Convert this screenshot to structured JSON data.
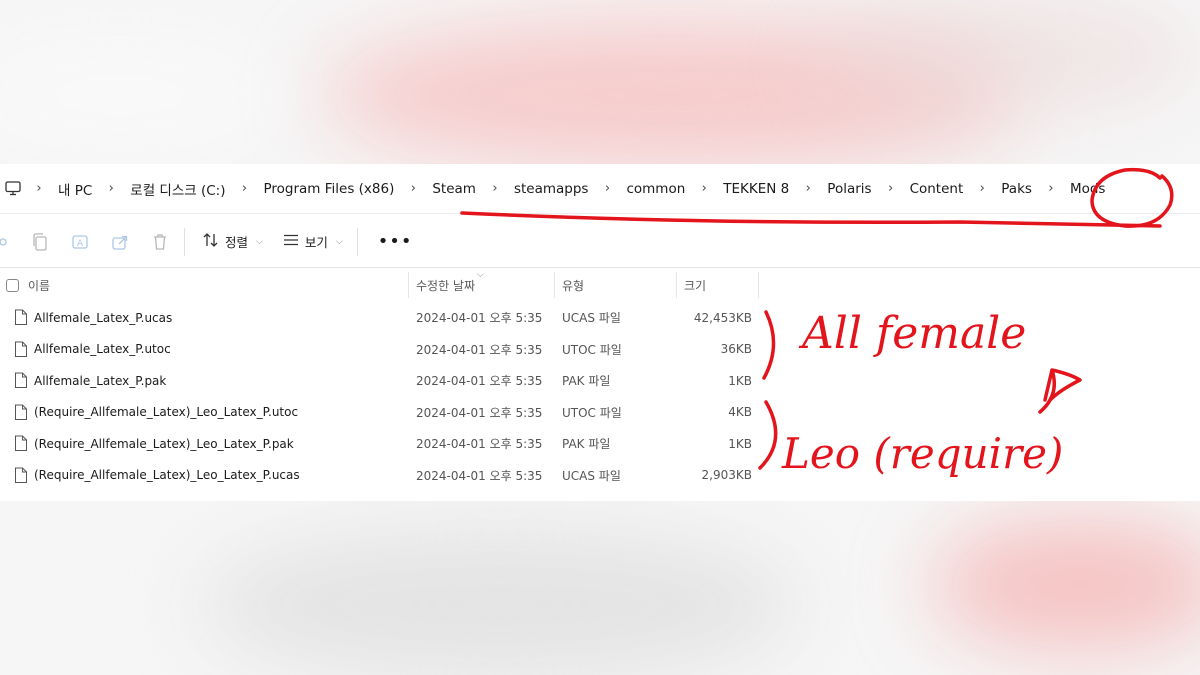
{
  "breadcrumb": {
    "items": [
      "내 PC",
      "로컬 디스크 (C:)",
      "Program Files (x86)",
      "Steam",
      "steamapps",
      "common",
      "TEKKEN 8",
      "Polaris",
      "Content",
      "Paks",
      "Mods"
    ],
    "separator": ">"
  },
  "toolbar": {
    "sort_label": "정렬",
    "view_label": "보기",
    "more_label": "•••"
  },
  "columns": {
    "name": "이름",
    "modified": "수정한 날짜",
    "type": "유형",
    "size": "크기"
  },
  "files": [
    {
      "name": "Allfemale_Latex_P.ucas",
      "modified": "2024-04-01 오후 5:35",
      "type": "UCAS 파일",
      "size": "42,453KB"
    },
    {
      "name": "Allfemale_Latex_P.utoc",
      "modified": "2024-04-01 오후 5:35",
      "type": "UTOC 파일",
      "size": "36KB"
    },
    {
      "name": "Allfemale_Latex_P.pak",
      "modified": "2024-04-01 오후 5:35",
      "type": "PAK 파일",
      "size": "1KB"
    },
    {
      "name": "(Require_Allfemale_Latex)_Leo_Latex_P.utoc",
      "modified": "2024-04-01 오후 5:35",
      "type": "UTOC 파일",
      "size": "4KB"
    },
    {
      "name": "(Require_Allfemale_Latex)_Leo_Latex_P.pak",
      "modified": "2024-04-01 오후 5:35",
      "type": "PAK 파일",
      "size": "1KB"
    },
    {
      "name": "(Require_Allfemale_Latex)_Leo_Latex_P.ucas",
      "modified": "2024-04-01 오후 5:35",
      "type": "UCAS 파일",
      "size": "2,903KB"
    }
  ],
  "annotations": {
    "text_1": "All female",
    "text_2": "Leo (require)",
    "color": "#e3141c"
  }
}
